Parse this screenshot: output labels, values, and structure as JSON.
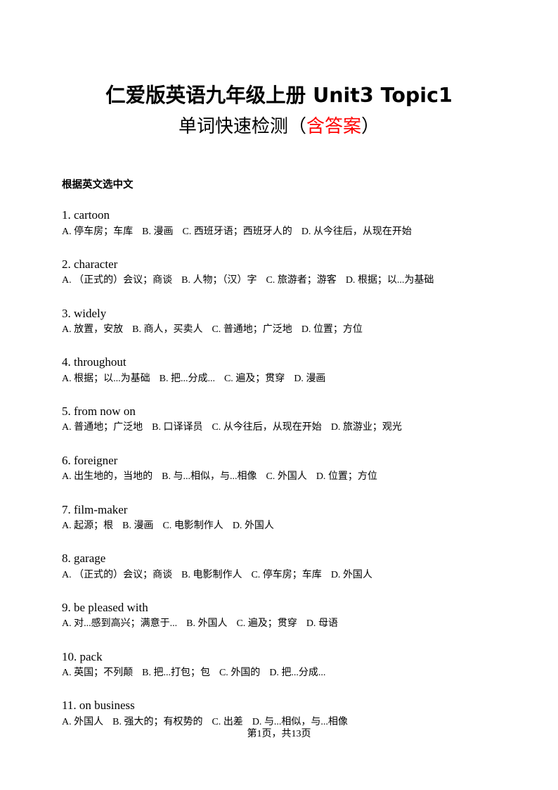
{
  "document": {
    "title": "仁爱版英语九年级上册 Unit3 Topic1",
    "subtitle_plain_before": "单词快速检测（",
    "subtitle_red": "含答案",
    "subtitle_plain_after": "）",
    "accent_color": "#ff0000",
    "text_color": "#000000",
    "background_color": "#ffffff"
  },
  "section": {
    "heading": "根据英文选中文"
  },
  "questions": [
    {
      "number": "1.",
      "prompt": "cartoon",
      "options": [
        {
          "letter": "A.",
          "text": "停车房；车库"
        },
        {
          "letter": "B.",
          "text": "漫画"
        },
        {
          "letter": "C.",
          "text": "西班牙语；西班牙人的"
        },
        {
          "letter": "D.",
          "text": "从今往后，从现在开始"
        }
      ]
    },
    {
      "number": "2.",
      "prompt": "character",
      "options": [
        {
          "letter": "A.",
          "text": "（正式的）会议；商谈"
        },
        {
          "letter": "B.",
          "text": "人物；（汉）字"
        },
        {
          "letter": "C.",
          "text": "旅游者；游客"
        },
        {
          "letter": "D.",
          "text": "根据；以...为基础"
        }
      ]
    },
    {
      "number": "3.",
      "prompt": "widely",
      "options": [
        {
          "letter": "A.",
          "text": "放置，安放"
        },
        {
          "letter": "B.",
          "text": "商人，买卖人"
        },
        {
          "letter": "C.",
          "text": "普通地；广泛地"
        },
        {
          "letter": "D.",
          "text": "位置；方位"
        }
      ]
    },
    {
      "number": "4.",
      "prompt": "throughout",
      "options": [
        {
          "letter": "A.",
          "text": "根据；以...为基础"
        },
        {
          "letter": "B.",
          "text": "把...分成..."
        },
        {
          "letter": "C.",
          "text": "遍及；贯穿"
        },
        {
          "letter": "D.",
          "text": "漫画"
        }
      ]
    },
    {
      "number": "5.",
      "prompt": "from now on",
      "options": [
        {
          "letter": "A.",
          "text": "普通地；广泛地"
        },
        {
          "letter": "B.",
          "text": "口译译员"
        },
        {
          "letter": "C.",
          "text": "从今往后，从现在开始"
        },
        {
          "letter": "D.",
          "text": "旅游业；观光"
        }
      ]
    },
    {
      "number": "6.",
      "prompt": "foreigner",
      "options": [
        {
          "letter": "A.",
          "text": "出生地的，当地的"
        },
        {
          "letter": "B.",
          "text": "与...相似，与...相像"
        },
        {
          "letter": "C.",
          "text": "外国人"
        },
        {
          "letter": "D.",
          "text": "位置；方位"
        }
      ]
    },
    {
      "number": "7.",
      "prompt": "film-maker",
      "options": [
        {
          "letter": "A.",
          "text": "起源；根"
        },
        {
          "letter": "B.",
          "text": "漫画"
        },
        {
          "letter": "C.",
          "text": "电影制作人"
        },
        {
          "letter": "D.",
          "text": "外国人"
        }
      ]
    },
    {
      "number": "8.",
      "prompt": "garage",
      "options": [
        {
          "letter": "A.",
          "text": "（正式的）会议；商谈"
        },
        {
          "letter": "B.",
          "text": "电影制作人"
        },
        {
          "letter": "C.",
          "text": "停车房；车库"
        },
        {
          "letter": "D.",
          "text": "外国人"
        }
      ]
    },
    {
      "number": "9.",
      "prompt": "be pleased with",
      "options": [
        {
          "letter": "A.",
          "text": "对...感到高兴；满意于..."
        },
        {
          "letter": "B.",
          "text": "外国人"
        },
        {
          "letter": "C.",
          "text": "遍及；贯穿"
        },
        {
          "letter": "D.",
          "text": "母语"
        }
      ]
    },
    {
      "number": "10.",
      "prompt": "pack",
      "options": [
        {
          "letter": "A.",
          "text": "英国；不列颠"
        },
        {
          "letter": "B.",
          "text": "把...打包；包"
        },
        {
          "letter": "C.",
          "text": "外国的"
        },
        {
          "letter": "D.",
          "text": "把...分成..."
        }
      ]
    },
    {
      "number": "11.",
      "prompt": "on business",
      "options": [
        {
          "letter": "A.",
          "text": "外国人"
        },
        {
          "letter": "B.",
          "text": "强大的；有权势的"
        },
        {
          "letter": "C.",
          "text": "出差"
        },
        {
          "letter": "D.",
          "text": "与...相似，与...相像"
        }
      ]
    }
  ],
  "footer": {
    "text": "第1页，共13页",
    "current_page": "1",
    "total_pages": "13"
  }
}
